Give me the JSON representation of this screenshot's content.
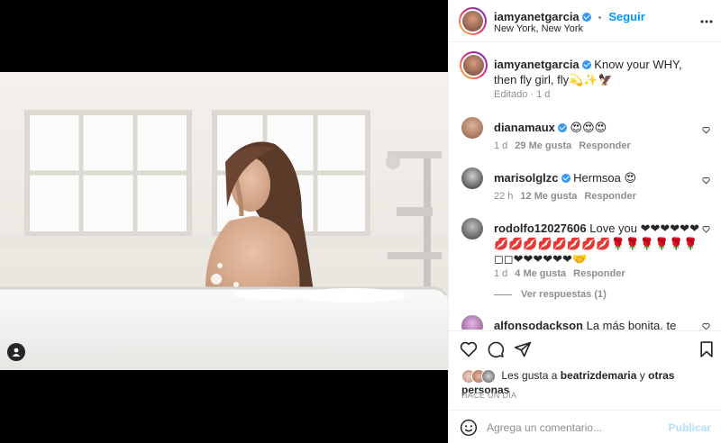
{
  "post": {
    "author": "iamyanetgarcia",
    "location": "New York, New York",
    "follow_label": "Seguir",
    "dot": "•",
    "more_label": "•••"
  },
  "caption": {
    "author": "iamyanetgarcia",
    "text": "Know your WHY, then fly girl, fly💫✨🦅",
    "meta": "Editado · 1 d"
  },
  "comments": [
    {
      "user": "dianamaux",
      "verified": true,
      "text": "😍😍😍",
      "time": "1 d",
      "likes": "29 Me gusta",
      "reply": "Responder"
    },
    {
      "user": "marisolglzc",
      "verified": true,
      "text": "Hermsoa 😍",
      "time": "22 h",
      "likes": "12 Me gusta",
      "reply": "Responder"
    },
    {
      "user": "rodolfo12027606",
      "verified": false,
      "text": "Love you ❤❤❤❤❤❤💋💋💋💋💋💋💋💋🌹🌹🌹🌹🌹🌹◻◻❤❤❤❤❤❤🤝",
      "time": "1 d",
      "likes": "4 Me gusta",
      "reply": "Responder"
    },
    {
      "user": "alfonsodackson",
      "verified": false,
      "text": "La más bonita, te adoro 🌻",
      "time": "",
      "likes": "",
      "reply": ""
    }
  ],
  "replies_label": "Ver respuestas (1)",
  "likes": {
    "prefix": "Les gusta a",
    "user": "beatrizdemaria",
    "middle": "y",
    "others": "otras personas"
  },
  "timestamp": "HACE UN DÍA",
  "add_comment": {
    "placeholder": "Agrega un comentario...",
    "publish": "Publicar"
  },
  "icons": [
    "heart-icon",
    "comment-icon",
    "share-icon",
    "bookmark-icon",
    "emoji-icon",
    "more-icon",
    "tag-user-icon"
  ],
  "colors": {
    "accent": "#0095f6",
    "verified": "#3897f0",
    "publish_disabled": "#b2dffc",
    "muted": "#8e8e8e"
  }
}
